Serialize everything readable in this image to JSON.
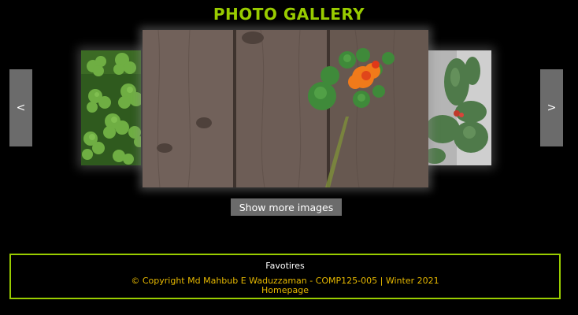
{
  "page": {
    "title": "PHOTO GALLERY"
  },
  "controls": {
    "prev_label": "<",
    "next_label": ">",
    "show_more_label": "Show more images"
  },
  "footer": {
    "favorites_link": "Favotires",
    "copyright": "© Copyright Md Mahbub E Waduzzaman - COMP125-005 | Winter 2021",
    "homepage_link": "Homepage"
  },
  "colors": {
    "accent": "#99cc00",
    "copyright_text": "#e6b800",
    "button_bg": "#6b6b6b",
    "background": "#000000"
  },
  "images": {
    "left": "clover-leaves-photo",
    "center": "flower-on-wooden-fence-photo",
    "right": "cactus-photo"
  }
}
